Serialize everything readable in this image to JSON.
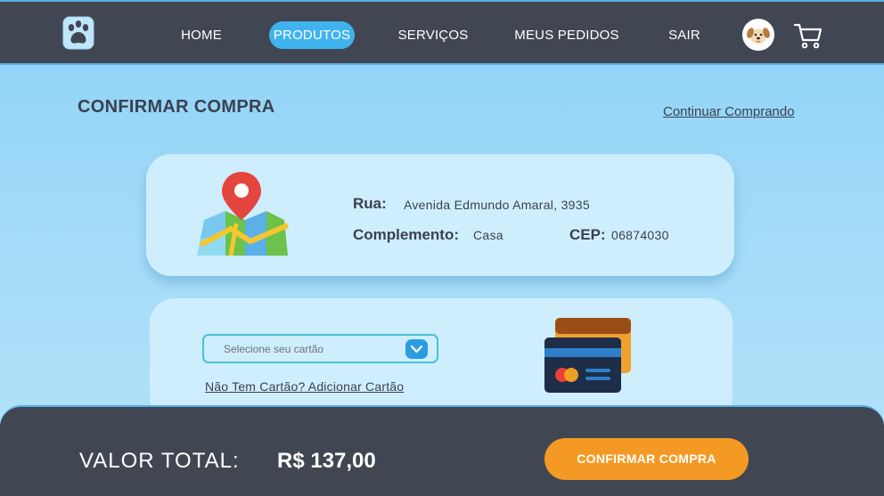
{
  "nav": {
    "items": [
      {
        "label": "HOME",
        "active": false
      },
      {
        "label": "PRODUTOS",
        "active": true
      },
      {
        "label": "SERVIÇOS",
        "active": false
      },
      {
        "label": "MEUS PEDIDOS",
        "active": false
      },
      {
        "label": "SAIR",
        "active": false
      }
    ],
    "logo_icon": "paw-icon",
    "avatar_icon": "dog-avatar",
    "cart_icon": "cart-icon"
  },
  "page": {
    "title": "CONFIRMAR COMPRA",
    "continue_link": "Continuar Comprando"
  },
  "address": {
    "icon": "map-pin-icon",
    "street_label": "Rua:",
    "street_value": "Avenida Edmundo Amaral, 3935",
    "complement_label": "Complemento:",
    "complement_value": "Casa",
    "cep_label": "CEP:",
    "cep_value": "06874030"
  },
  "payment": {
    "select_placeholder": "Selecione seu cartão",
    "add_card_link": "Não Tem Cartão? Adicionar Cartão",
    "icon": "credit-card-icon"
  },
  "footer": {
    "total_label": "VALOR TOTAL:",
    "total_value": "R$ 137,00",
    "confirm_button": "CONFIRMAR COMPRA"
  },
  "colors": {
    "nav_bg": "#414752",
    "active_tab": "#3fb3ee",
    "page_bg": "#8ed3f7",
    "card_bg": "#cfeefd",
    "confirm_button": "#f49a24"
  }
}
